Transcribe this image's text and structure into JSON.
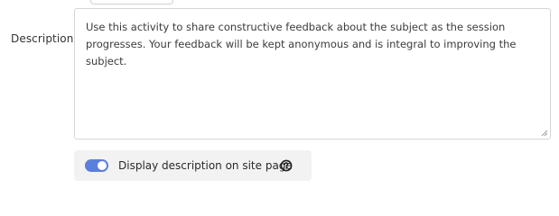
{
  "description_field": {
    "label": "Description",
    "value": "Use this activity to share constructive feedback about the subject as the session progresses. Your feedback will be kept anonymous and is integral to improving the subject."
  },
  "display_toggle": {
    "label": "Display description on site page",
    "enabled": true,
    "help_icon": "question-circle-icon"
  },
  "colors": {
    "toggle_on": "#5b7fdc",
    "toggle_row_bg": "#f2f2f2",
    "border": "#d6d6d6"
  }
}
